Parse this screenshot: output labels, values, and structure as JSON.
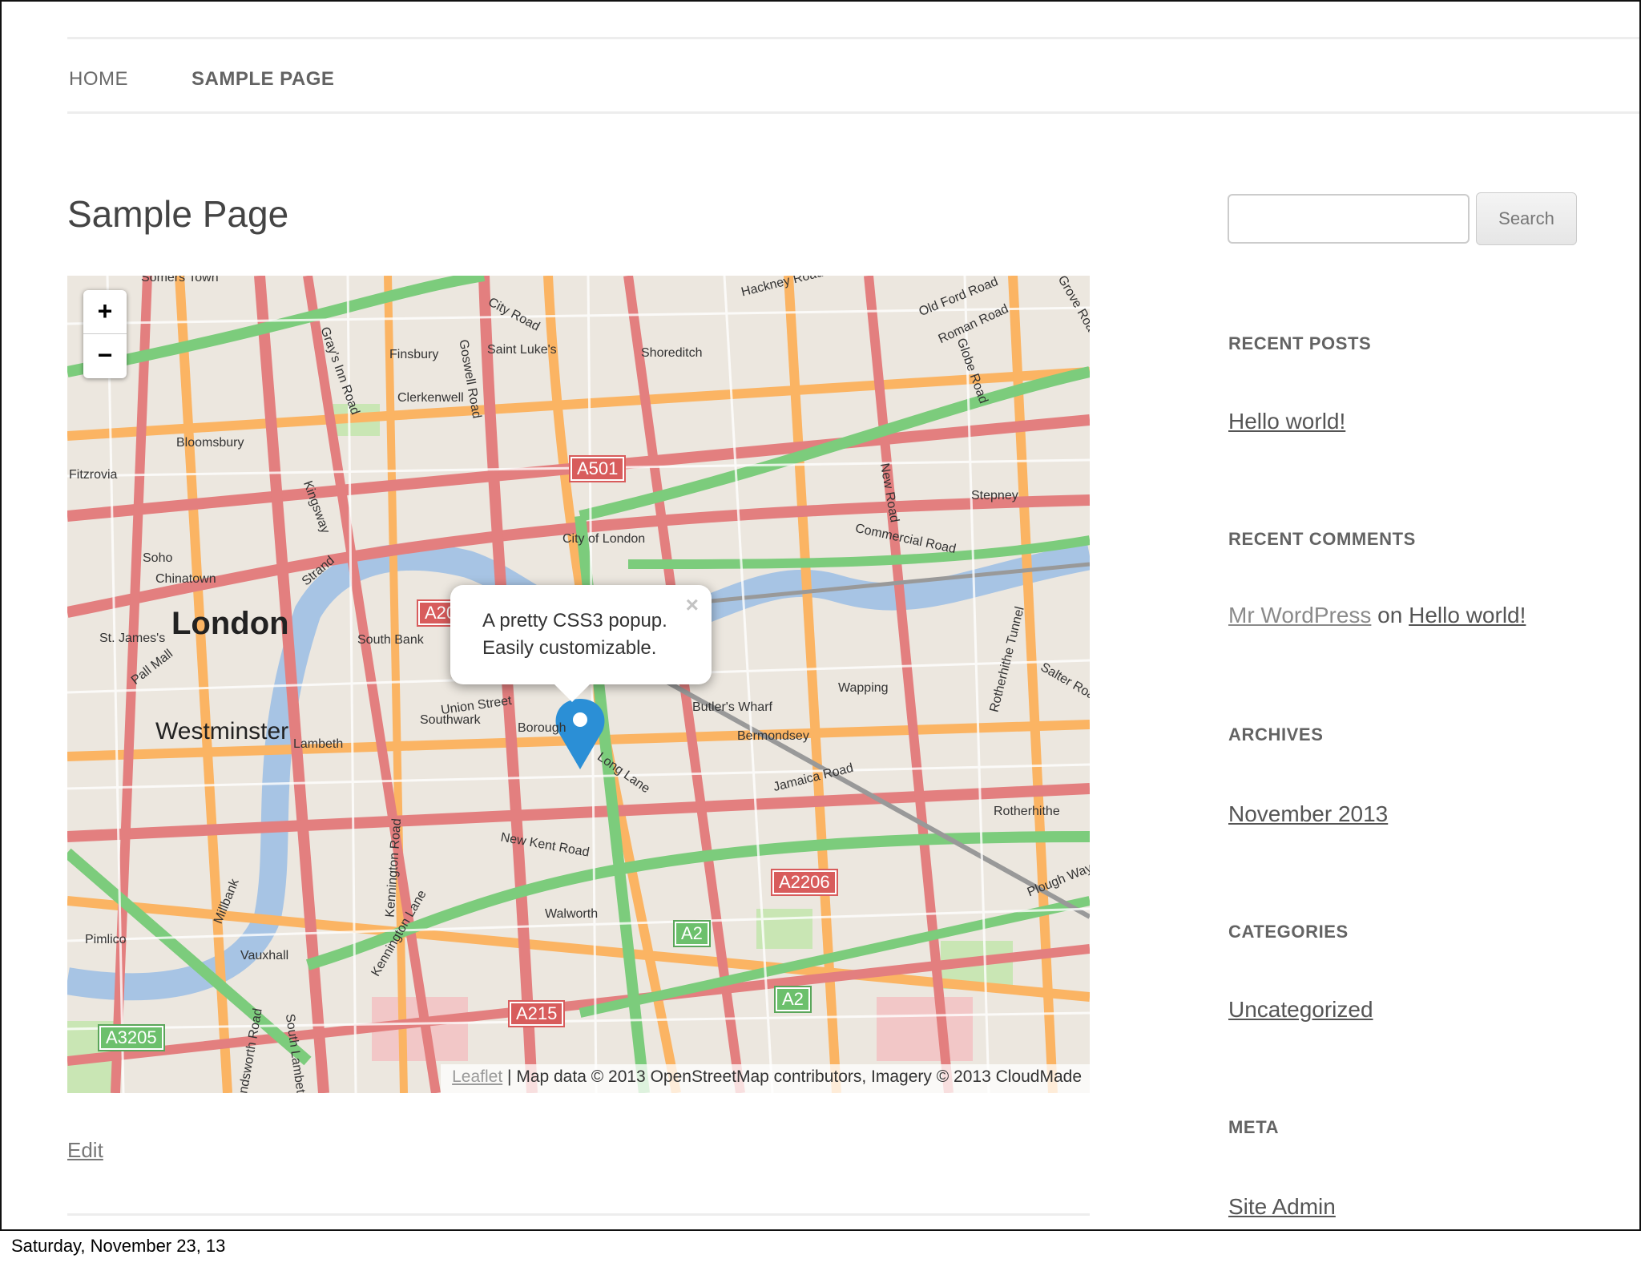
{
  "nav": {
    "home": "HOME",
    "sample_page": "SAMPLE PAGE"
  },
  "page_title": "Sample Page",
  "map": {
    "zoom_in": "+",
    "zoom_out": "−",
    "popup_line1": "A pretty CSS3 popup.",
    "popup_line2": "Easily customizable.",
    "popup_close": "×",
    "attribution_leaflet": "Leaflet",
    "attribution_text": "| Map data © 2013 OpenStreetMap contributors, Imagery © 2013 CloudMade",
    "labels": {
      "somers_town": "Somers Town",
      "hackney_road": "Hackney Road",
      "old_ford_road": "Old Ford Road",
      "roman_road": "Roman Road",
      "grove_road": "Grove Road",
      "globe_road": "Globe Road",
      "city_road": "City Road",
      "finsbury": "Finsbury",
      "saint_lukes": "Saint Luke's",
      "shoreditch": "Shoreditch",
      "goswell_road": "Goswell Road",
      "grays_inn_road": "Gray's Inn Road",
      "clerkenwell": "Clerkenwell",
      "bloomsbury": "Bloomsbury",
      "fitzrovia": "Fitzrovia",
      "kingsway": "Kingsway",
      "new_road": "New Road",
      "stepney": "Stepney",
      "city_of_london": "City of London",
      "commercial_road": "Commercial Road",
      "soho": "Soho",
      "chinatown": "Chinatown",
      "strand": "Strand",
      "london": "London",
      "st_james": "St. James's",
      "pall_mall": "Pall Mall",
      "south_bank": "South Bank",
      "union_street": "Union Street",
      "southwark": "Southwark",
      "borough": "Borough",
      "butlers_wharf": "Butler's Wharf",
      "wapping": "Wapping",
      "rotherhithe_tunnel": "Rotherhithe Tunnel",
      "salter_road": "Salter Road",
      "bermondsey": "Bermondsey",
      "westminster": "Westminster",
      "lambeth": "Lambeth",
      "long_lane": "Long Lane",
      "jamaica_road": "Jamaica Road",
      "rotherhithe": "Rotherhithe",
      "new_kent_road": "New Kent Road",
      "kennington_road": "Kennington Road",
      "kennington_lane": "Kennington Lane",
      "walworth": "Walworth",
      "millbank": "Millbank",
      "pimlico": "Pimlico",
      "vauxhall": "Vauxhall",
      "plough_way": "Plough Way",
      "south_lambeth": "South Lambeth",
      "wandsworth_road": "Wandsworth Road"
    },
    "shields": {
      "a501": "A501",
      "a20": "A20",
      "a2206": "A2206",
      "a2_top": "A2",
      "a2_bottom": "A2",
      "a215": "A215",
      "a3205": "A3205"
    },
    "colors": {
      "background": "#ece7df",
      "major_road": "#e37f7f",
      "a_road": "#fbb463",
      "green_road": "#7ccc7c",
      "river": "#a7c4e4",
      "marker": "#2b8fd6"
    }
  },
  "edit_link": "Edit",
  "sidebar": {
    "search_placeholder": "",
    "search_button": "Search",
    "recent_posts_title": "RECENT POSTS",
    "recent_post_1": "Hello world!",
    "recent_comments_title": "RECENT COMMENTS",
    "comment_author": "Mr WordPress",
    "comment_on": "on",
    "comment_post": "Hello world!",
    "archives_title": "ARCHIVES",
    "archive_1": "November 2013",
    "categories_title": "CATEGORIES",
    "category_1": "Uncategorized",
    "meta_title": "META",
    "meta_1": "Site Admin"
  },
  "caption": "Saturday, November 23, 13"
}
